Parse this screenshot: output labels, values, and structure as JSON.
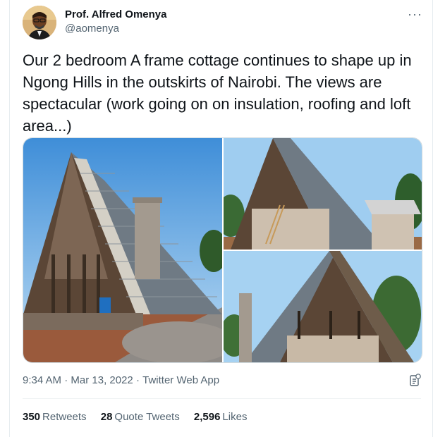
{
  "author": {
    "name": "Prof. Alfred Omenya",
    "handle": "@aomenya"
  },
  "tweet": {
    "text": "Our 2 bedroom A frame cottage continues to shape up in Ngong Hills in the outskirts of Nairobi. The views are spectacular (work going on on insulation, roofing and loft area...)"
  },
  "icons": {
    "more": "more-icon",
    "analytics": "analytics-icon"
  },
  "meta": {
    "time": "9:34 AM",
    "sep1": " · ",
    "date": "Mar 13, 2022",
    "sep2": " · ",
    "source": "Twitter Web App"
  },
  "stats": {
    "retweets_count": "350",
    "retweets_label": "Retweets",
    "quotes_count": "28",
    "quotes_label": "Quote Tweets",
    "likes_count": "2,596",
    "likes_label": "Likes"
  },
  "colors": {
    "text": "#0f1419",
    "secondary": "#536471",
    "border": "#cfd9de"
  }
}
